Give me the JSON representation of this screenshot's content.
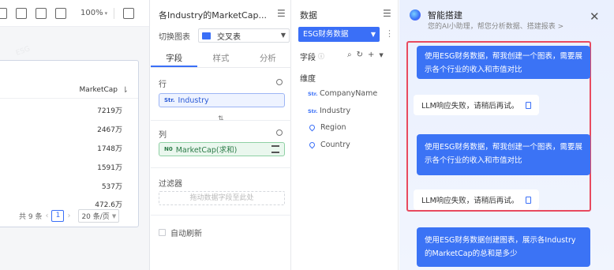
{
  "toolbar": {
    "zoom": "100%"
  },
  "canvas": {
    "column_header": "MarketCap",
    "values": [
      "7219万",
      "2467万",
      "1748万",
      "1591万",
      "537万",
      "472.6万"
    ],
    "pager": {
      "total": "共 9 条",
      "page": "1",
      "page_size": "20 条/页"
    }
  },
  "config": {
    "title": "各Industry的MarketCap...",
    "chart_type_label": "切换图表",
    "chart_type": "交叉表",
    "tabs": [
      "字段",
      "样式",
      "分析"
    ],
    "rows_label": "行",
    "row_field": {
      "type": "Str.",
      "name": "Industry"
    },
    "cols_label": "列",
    "col_field": {
      "type": "N0",
      "name": "MarketCap(求和)"
    },
    "swap_glyph": "⇅",
    "filter_label": "过滤器",
    "filter_placeholder": "拖动数据字段至此处",
    "auto_refresh": "自动刷新"
  },
  "data_panel": {
    "title": "数据",
    "dataset": "ESG财务数据",
    "fields_label": "字段",
    "dimension_label": "维度",
    "dimensions": [
      {
        "type": "Str.",
        "name": "CompanyName",
        "icon": "text"
      },
      {
        "type": "Str.",
        "name": "Industry",
        "icon": "text"
      },
      {
        "type": "",
        "name": "Region",
        "icon": "geo"
      },
      {
        "type": "",
        "name": "Country",
        "icon": "geo"
      }
    ]
  },
  "assistant": {
    "title": "智能搭建",
    "subtitle": "您的AI小助理，帮您分析数据、搭建报表 >",
    "close": "✕",
    "messages": [
      {
        "role": "user",
        "text": "使用ESG财务数据，帮我创建一个图表，需要展示各个行业的收入和市值对比"
      },
      {
        "role": "bot",
        "text": "LLM响应失败，请稍后再试。"
      },
      {
        "role": "user",
        "text": "使用ESG财务数据，帮我创建一个图表，需要展示各个行业的收入和市值对比"
      },
      {
        "role": "bot",
        "text": "LLM响应失败，请稍后再试。"
      },
      {
        "role": "user",
        "text": "使用ESG财务数据创建图表，展示各Industry的MarketCap的总和是多少"
      }
    ],
    "highlight_color": "#e84a5f",
    "accent_color": "#3b73f5"
  }
}
